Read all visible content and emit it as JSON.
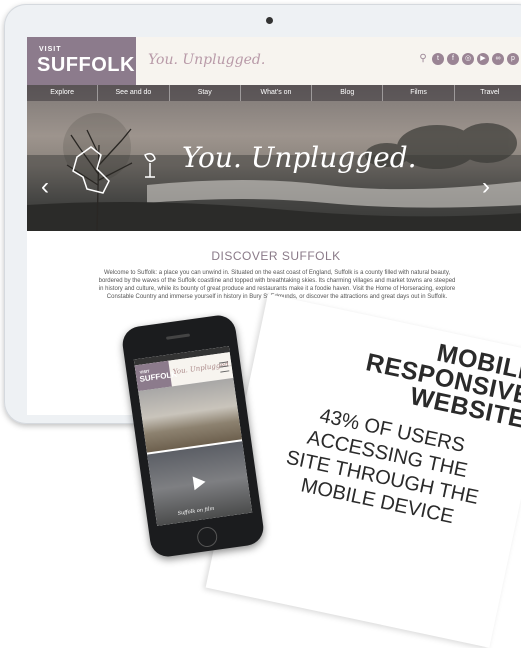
{
  "site": {
    "logo_visit": "VISIT",
    "logo_name": "SUFFOLK",
    "tagline": "You. Unplugged.",
    "social_icons": [
      "search-icon",
      "twitter-icon",
      "facebook-icon",
      "instagram-icon",
      "youtube-icon",
      "tripadvisor-icon",
      "pinterest-icon"
    ]
  },
  "nav": {
    "items": [
      "Explore",
      "See and do",
      "Stay",
      "What's on",
      "Blog",
      "Films",
      "Travel"
    ]
  },
  "hero": {
    "title": "You. Unplugged.",
    "prev": "‹",
    "next": "›"
  },
  "content": {
    "heading": "DISCOVER SUFFOLK",
    "paragraph": "Welcome to Suffolk: a place you can unwind in. Situated on the east coast of England, Suffolk is a county filled with natural beauty, bordered by the waves of the Suffolk coastline and topped with breathtaking skies. Its charming villages and market towns are steeped in history and culture, while its bounty of great produce and restaurants make it a foodie haven. Visit the Home of Horseracing, explore Constable Country and immerse yourself in history in Bury St Edmunds, or discover the attractions and great days out in Suffolk."
  },
  "phone": {
    "logo_visit": "VISIT",
    "logo_name": "SUFFOLK",
    "tagline": "You. Unplugged.",
    "caption": "Suffolk on film"
  },
  "promo": {
    "title_lines": [
      "MOBILE",
      "RESPONSIVE",
      "WEBSITE"
    ],
    "sub_lines": [
      "43% OF USERS",
      "ACCESSING THE",
      "SITE THROUGH THE",
      "MOBILE DEVICE"
    ]
  },
  "colors": {
    "brand": "#8c7b8c",
    "tagline": "#b89aa8"
  }
}
